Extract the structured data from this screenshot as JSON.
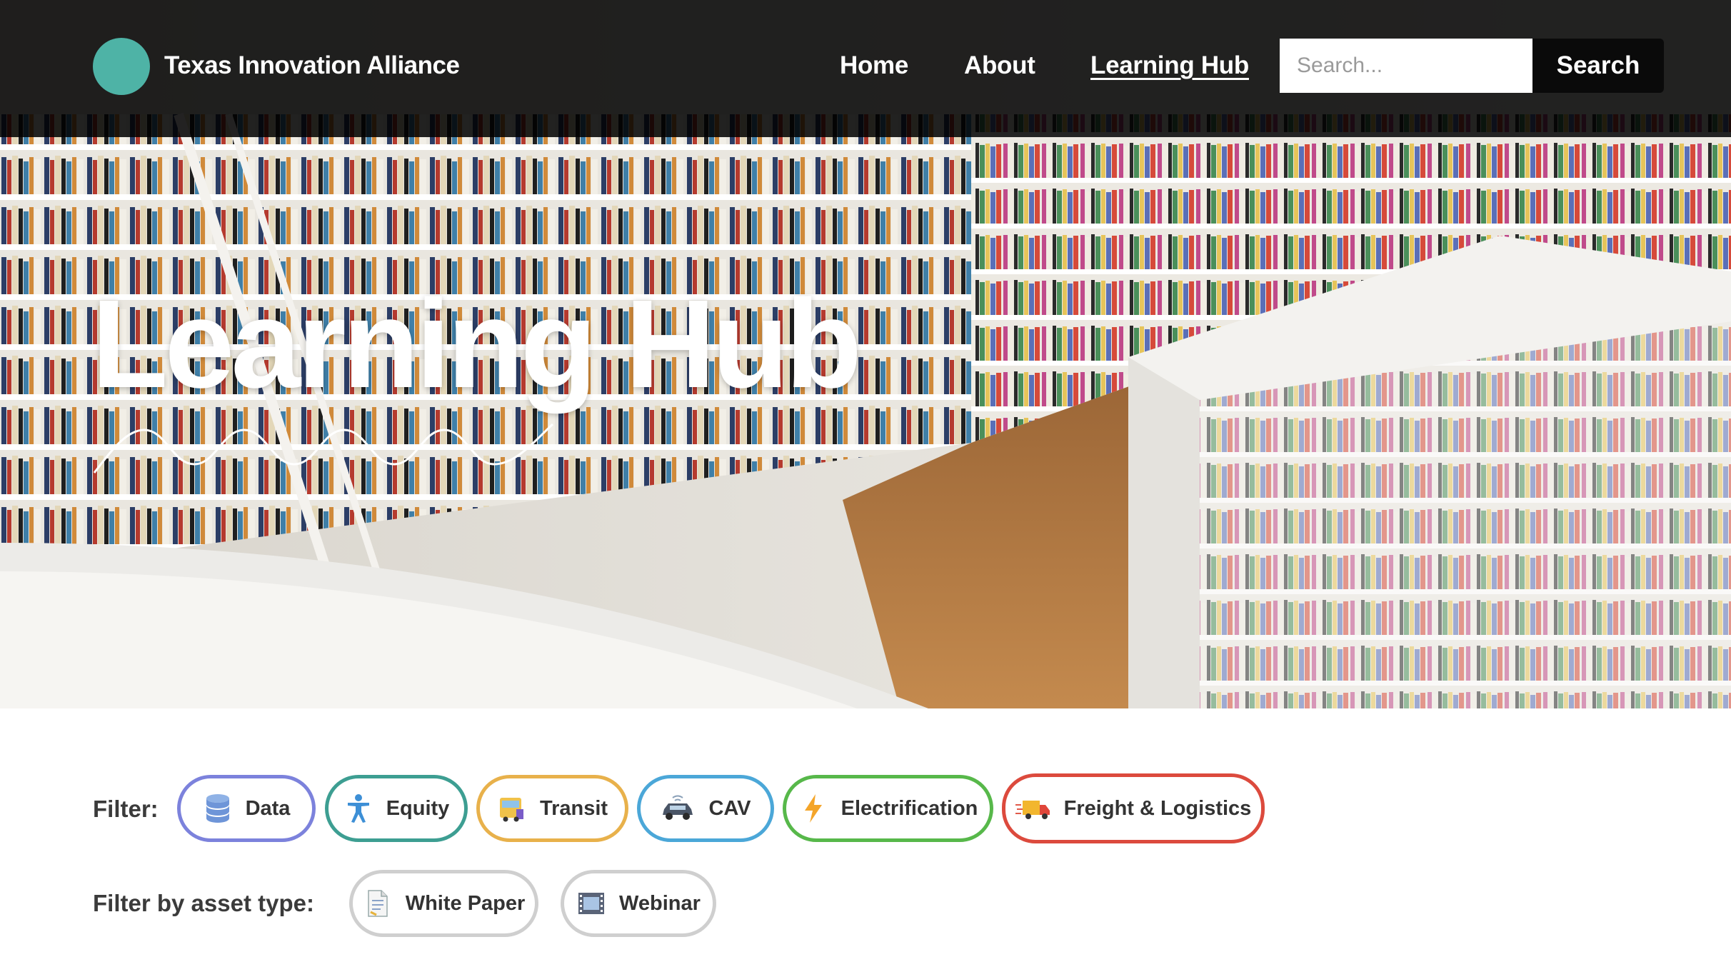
{
  "brand": {
    "name": "Texas Innovation Alliance",
    "logo_color": "#4eb3a6"
  },
  "nav": {
    "items": [
      {
        "label": "Home",
        "active": false
      },
      {
        "label": "About",
        "active": false
      },
      {
        "label": "Learning Hub",
        "active": true
      }
    ]
  },
  "search": {
    "placeholder": "Search...",
    "value": "",
    "button_label": "Search"
  },
  "hero": {
    "title": "Learning Hub",
    "background": "library-bookshelves-photo"
  },
  "filters": {
    "topic_label": "Filter:",
    "topics": [
      {
        "label": "Data",
        "icon": "database-icon",
        "color": "#7c82dc"
      },
      {
        "label": "Equity",
        "icon": "accessibility-person-icon",
        "color": "#3d9e92"
      },
      {
        "label": "Transit",
        "icon": "bus-icon",
        "color": "#e8b14b"
      },
      {
        "label": "CAV",
        "icon": "connected-vehicle-icon",
        "color": "#4ba7d8"
      },
      {
        "label": "Electrification",
        "icon": "lightning-bolt-icon",
        "color": "#57b84a"
      },
      {
        "label": "Freight & Logistics",
        "icon": "delivery-truck-icon",
        "color": "#dc4a3d"
      }
    ],
    "asset_type_label": "Filter by asset type:",
    "asset_types": [
      {
        "label": "White Paper",
        "icon": "document-icon"
      },
      {
        "label": "Webinar",
        "icon": "film-strip-icon"
      }
    ]
  }
}
